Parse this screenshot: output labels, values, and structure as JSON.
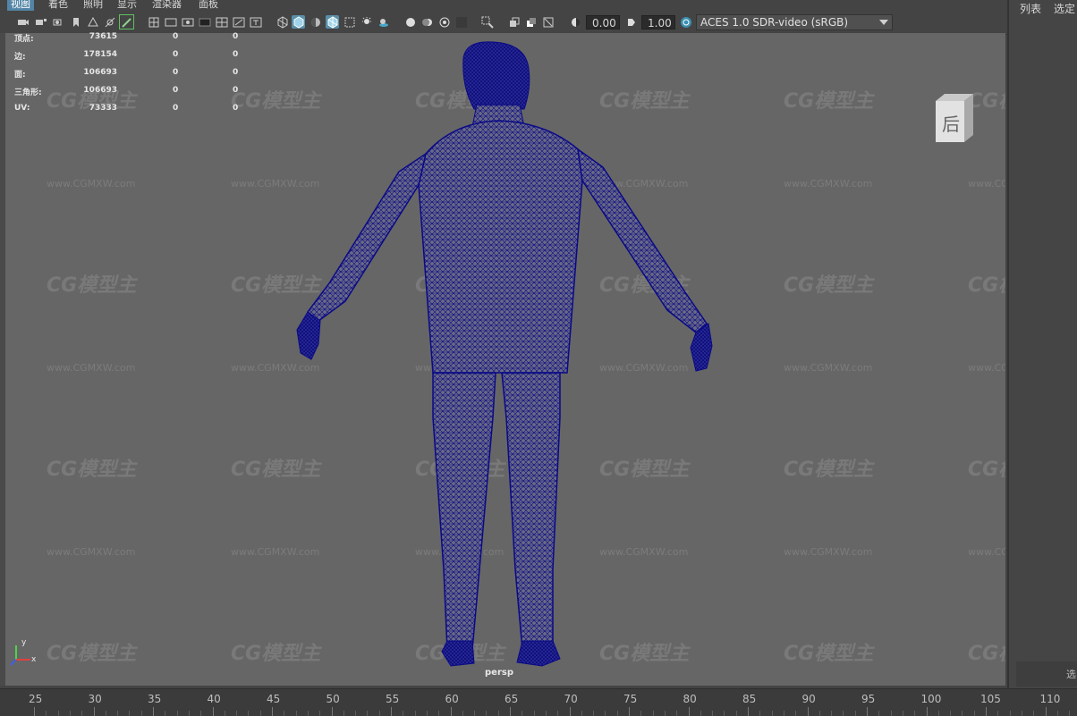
{
  "menu": [
    "视图",
    "着色",
    "照明",
    "显示",
    "渲染器",
    "面板"
  ],
  "toolbar": {
    "exposure": "0.00",
    "gamma": "1.00",
    "color_space": "ACES 1.0 SDR-video (sRGB)"
  },
  "hud": {
    "rows": [
      {
        "label": "顶点:",
        "v1": "73615",
        "v2": "0",
        "v3": "0"
      },
      {
        "label": "边:",
        "v1": "178154",
        "v2": "0",
        "v3": "0"
      },
      {
        "label": "面:",
        "v1": "106693",
        "v2": "0",
        "v3": "0"
      },
      {
        "label": "三角形:",
        "v1": "106693",
        "v2": "0",
        "v3": "0"
      },
      {
        "label": "UV:",
        "v1": "73333",
        "v2": "0",
        "v3": "0"
      }
    ]
  },
  "viewcube_label": "后",
  "camera_label": "persp",
  "axis": {
    "y": "y",
    "x": "x"
  },
  "right_panel": {
    "list_label": "列表",
    "select_label": "选定",
    "bottom_label": "选"
  },
  "watermark": {
    "logo": "CG模型主",
    "url": "www.CGMXW.com"
  },
  "timeline_ticks": [
    "25",
    "30",
    "35",
    "40",
    "45",
    "50",
    "55",
    "60",
    "65",
    "70",
    "75",
    "80",
    "85",
    "90",
    "95",
    "100",
    "105",
    "110"
  ],
  "colors": {
    "wireframe": "#0a0a86",
    "viewport_bg": "#666666",
    "active_menu": "#5285a6"
  }
}
